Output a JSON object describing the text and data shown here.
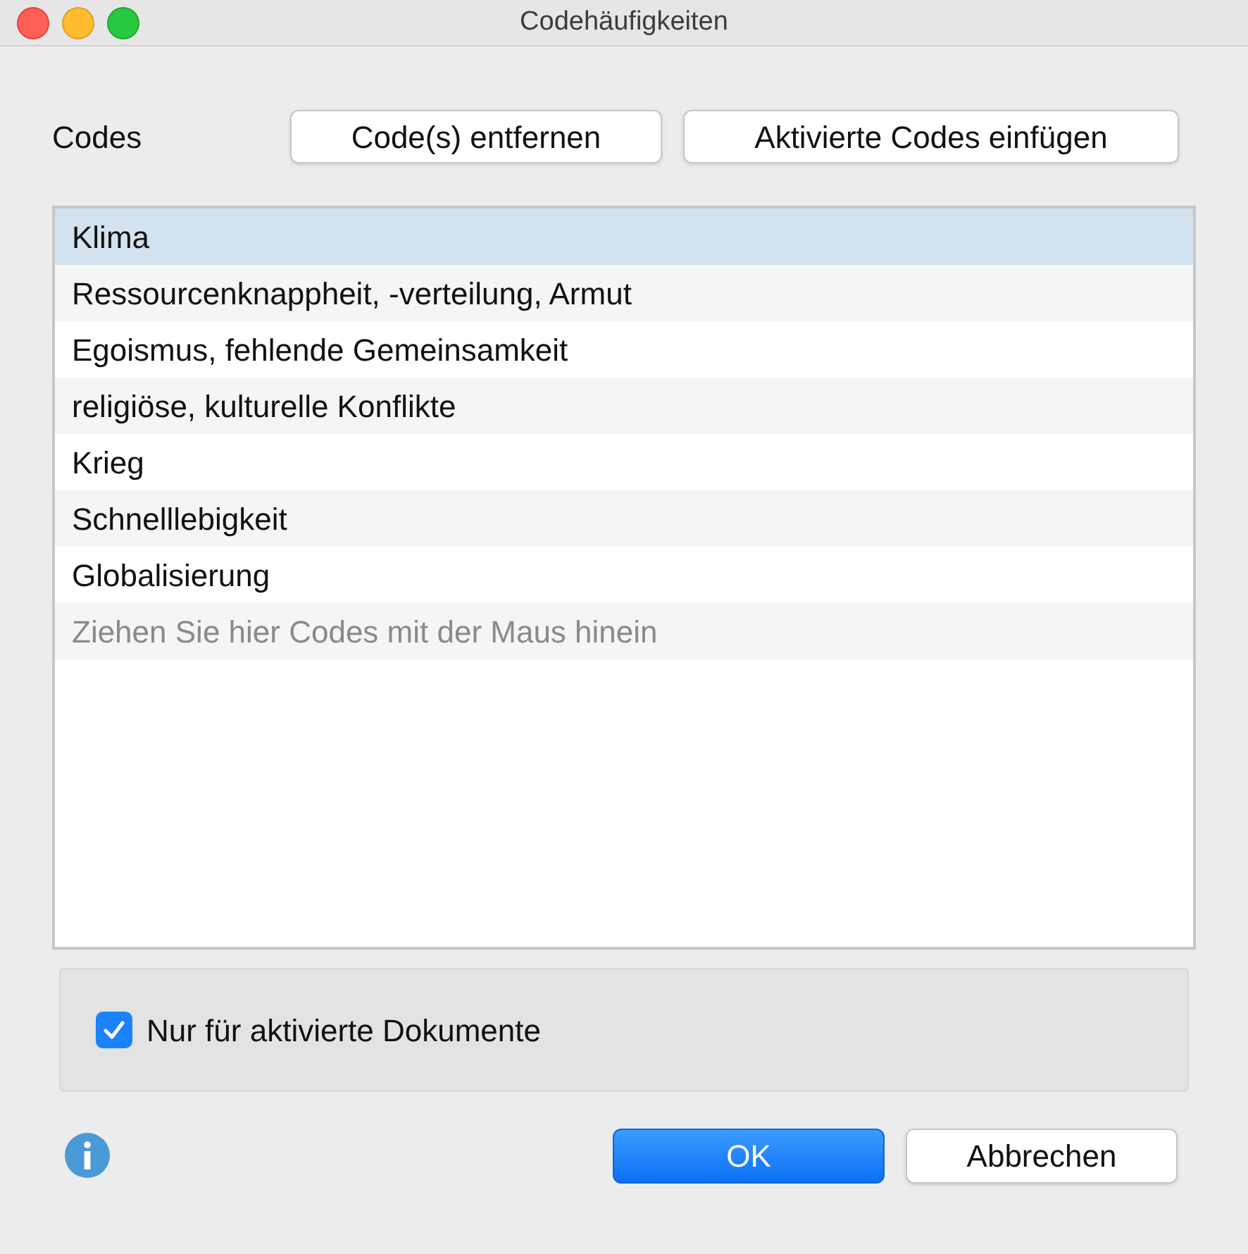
{
  "window": {
    "title": "Codehäufigkeiten"
  },
  "codes_label": "Codes",
  "toolbar_buttons": [
    "Code(s) entfernen",
    "Aktivierte Codes einfügen"
  ],
  "codes": [
    {
      "label": "Klima",
      "selected": true
    },
    {
      "label": "Ressourcenknappheit, -verteilung, Armut",
      "selected": false
    },
    {
      "label": "Egoismus, fehlende Gemeinsamkeit",
      "selected": false
    },
    {
      "label": "religiöse, kulturelle Konflikte",
      "selected": false
    },
    {
      "label": "Krieg",
      "selected": false
    },
    {
      "label": "Schnelllebigkeit",
      "selected": false
    },
    {
      "label": "Globalisierung",
      "selected": false
    }
  ],
  "drop_hint": "Ziehen Sie hier Codes mit der Maus hinein",
  "option": {
    "label": "Nur für aktivierte Dokumente",
    "checked": true
  },
  "buttons": [
    {
      "label": "OK",
      "kind": "primary"
    },
    {
      "label": "Abbrechen",
      "kind": "secondary"
    }
  ]
}
